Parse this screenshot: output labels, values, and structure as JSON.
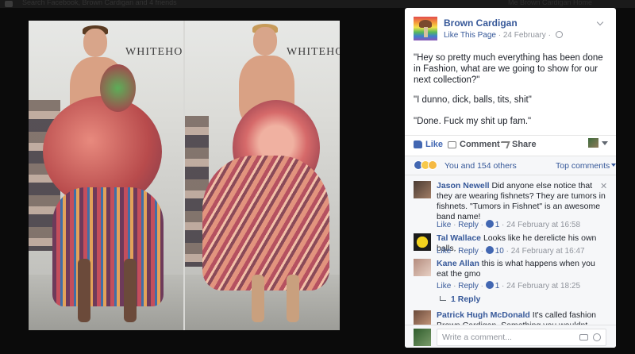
{
  "browser": {
    "tab_text": "Search Facebook, Brown Cardigan and 4 friends",
    "right_text": "Me  Brown Cardigan  Home"
  },
  "post": {
    "page_name": "Brown Cardigan",
    "like_page": "Like This Page",
    "date": "24 February",
    "paragraphs": [
      "\"Hey so pretty much everything has been done in Fashion, what are we going to show for our next collection?\"",
      "\"I dunno, dick, balls, tits, shit\"",
      "\"Done. Fuck my shit up fam.\""
    ],
    "actions": {
      "like": "Like",
      "comment": "Comment",
      "share": "Share"
    }
  },
  "photo": {
    "backdrop_left": "WHITEHO",
    "backdrop_right": "WHITEHO"
  },
  "reactions": {
    "text": "You and 154 others",
    "top_comments": "Top comments"
  },
  "comments": [
    {
      "name": "Jason Newell",
      "text": "Did anyone else notice that they are wearing fishnets? They are tumors in fishnets. \"Tumors in Fishnet\" is an awesome band name!",
      "like": "Like",
      "reply": "Reply",
      "likes": "1",
      "time": "24 February at 16:58"
    },
    {
      "name": "Tal Wallace",
      "text": "Looks like he derelicte his own balls.",
      "like": "Like",
      "reply": "Reply",
      "likes": "10",
      "time": "24 February at 16:47"
    },
    {
      "name": "Kane Allan",
      "text": "this is what happens when you eat the gmo",
      "like": "Like",
      "reply": "Reply",
      "likes": "1",
      "time": "24 February at 18:25",
      "replies": "1 Reply"
    },
    {
      "name": "Patrick Hugh McDonald",
      "text": "It's called fashion Brown Cardigan. Something you wouldnt know much"
    }
  ],
  "composer": {
    "placeholder": "Write a comment..."
  },
  "colors": {
    "link_blue": "#365899",
    "fb_blue": "#4267b2",
    "panel_bg": "#ffffff",
    "overlay_bg": "#0b0b0b"
  }
}
